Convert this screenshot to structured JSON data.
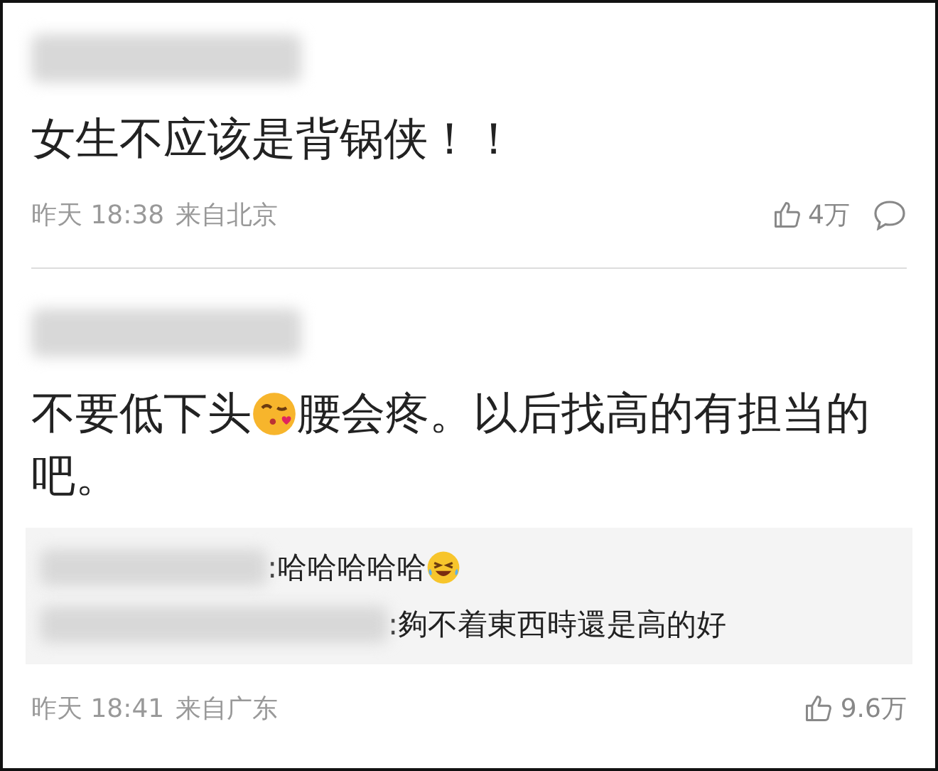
{
  "comments": [
    {
      "content": [
        {
          "kind": "text",
          "text": "女生不应该是背锅侠！！"
        }
      ],
      "time": "昨天 18:38",
      "source": "来自北京",
      "likes": "4万",
      "show_comment_icon": true
    },
    {
      "content": [
        {
          "kind": "text",
          "text": "不要低下头"
        },
        {
          "kind": "kiss"
        },
        {
          "kind": "text",
          "text": "腰会疼。以后找高的有担当的"
        },
        {
          "kind": "text",
          "text": "吧。"
        }
      ],
      "replies": [
        {
          "content": [
            {
              "kind": "text",
              "text": ":哈哈哈哈哈"
            },
            {
              "kind": "laugh"
            }
          ]
        },
        {
          "content": [
            {
              "kind": "text",
              "text": ":夠不着東西時還是高的好"
            }
          ]
        }
      ],
      "time": "昨天 18:41",
      "source": "来自广东",
      "likes": "9.6万",
      "show_comment_icon": false
    }
  ]
}
